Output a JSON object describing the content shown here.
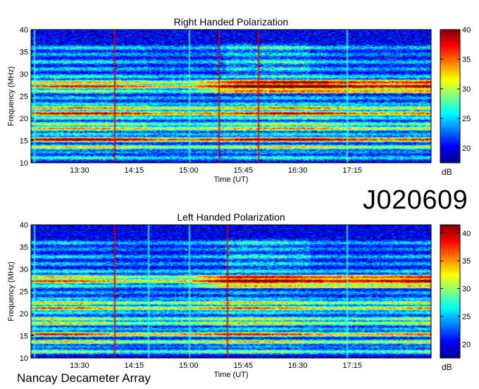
{
  "figure": {
    "observation_code": "J020609",
    "footer": "Nancay Decameter Array"
  },
  "colors": {
    "colormap": [
      "#00008f",
      "#0000ff",
      "#0080ff",
      "#00ffff",
      "#80ff80",
      "#ffff00",
      "#ff8000",
      "#ff0000",
      "#800000"
    ]
  },
  "chart_data": [
    {
      "type": "heatmap",
      "title": "Right Handed Polarization",
      "xlabel": "Time (UT)",
      "ylabel": "Frequency (MHz)",
      "x_ticks": [
        "13:30",
        "14:15",
        "15:00",
        "15:45",
        "16:30",
        "17:15"
      ],
      "x_tick_minutes": [
        810,
        855,
        900,
        945,
        990,
        1035
      ],
      "xlim_minutes": [
        770,
        1100
      ],
      "y_ticks": [
        10,
        15,
        20,
        25,
        30,
        35,
        40
      ],
      "ylim": [
        10,
        40
      ],
      "colorbar": {
        "label": "dB",
        "ticks": [
          20,
          25,
          30,
          35,
          40
        ],
        "range": [
          17.5,
          40
        ]
      },
      "features": {
        "background_db": 19.5,
        "bands": [
          {
            "freq_mhz": 11.2,
            "db": 27
          },
          {
            "freq_mhz": 12.5,
            "db": 24
          },
          {
            "freq_mhz": 13.6,
            "db": 32
          },
          {
            "freq_mhz": 15.3,
            "db": 40
          },
          {
            "freq_mhz": 16.5,
            "db": 26
          },
          {
            "freq_mhz": 17.8,
            "db": 34
          },
          {
            "freq_mhz": 18.8,
            "db": 30
          },
          {
            "freq_mhz": 20.2,
            "db": 28
          },
          {
            "freq_mhz": 21.2,
            "db": 38
          },
          {
            "freq_mhz": 22.4,
            "db": 34
          },
          {
            "freq_mhz": 23.3,
            "db": 26
          },
          {
            "freq_mhz": 24.7,
            "db": 25
          },
          {
            "freq_mhz": 26.2,
            "db": 29
          },
          {
            "freq_mhz": 27.3,
            "db": 37
          },
          {
            "freq_mhz": 28.2,
            "db": 33
          },
          {
            "freq_mhz": 29.5,
            "db": 27
          },
          {
            "freq_mhz": 31.2,
            "db": 25
          },
          {
            "freq_mhz": 32.8,
            "db": 26
          },
          {
            "freq_mhz": 34.5,
            "db": 24
          },
          {
            "freq_mhz": 36.0,
            "db": 26
          }
        ],
        "red_verticals_minutes": [
          839,
          925,
          957
        ],
        "cyan_verticals_minutes": [
          772,
          900,
          1030
        ]
      }
    },
    {
      "type": "heatmap",
      "title": "Left Handed Polarization",
      "xlabel": "Time (UT)",
      "ylabel": "Frequency (MHz)",
      "x_ticks": [
        "13:30",
        "14:15",
        "15:00",
        "15:45",
        "16:30",
        "17:15"
      ],
      "x_tick_minutes": [
        810,
        855,
        900,
        945,
        990,
        1035
      ],
      "xlim_minutes": [
        770,
        1100
      ],
      "y_ticks": [
        10,
        15,
        20,
        25,
        30,
        35,
        40
      ],
      "ylim": [
        10,
        40
      ],
      "colorbar": {
        "label": "dB",
        "ticks": [
          20,
          25,
          30,
          35,
          40
        ],
        "range": [
          17.5,
          41.5
        ]
      },
      "features": {
        "background_db": 19.5,
        "bands": [
          {
            "freq_mhz": 11.5,
            "db": 30
          },
          {
            "freq_mhz": 12.6,
            "db": 24
          },
          {
            "freq_mhz": 13.7,
            "db": 33
          },
          {
            "freq_mhz": 15.4,
            "db": 38
          },
          {
            "freq_mhz": 16.6,
            "db": 26
          },
          {
            "freq_mhz": 17.9,
            "db": 33
          },
          {
            "freq_mhz": 18.9,
            "db": 31
          },
          {
            "freq_mhz": 20.3,
            "db": 27
          },
          {
            "freq_mhz": 21.3,
            "db": 36
          },
          {
            "freq_mhz": 22.5,
            "db": 33
          },
          {
            "freq_mhz": 23.4,
            "db": 26
          },
          {
            "freq_mhz": 24.8,
            "db": 25
          },
          {
            "freq_mhz": 26.3,
            "db": 28
          },
          {
            "freq_mhz": 27.4,
            "db": 37
          },
          {
            "freq_mhz": 28.3,
            "db": 33
          },
          {
            "freq_mhz": 29.6,
            "db": 27
          },
          {
            "freq_mhz": 31.3,
            "db": 25
          },
          {
            "freq_mhz": 32.9,
            "db": 26
          },
          {
            "freq_mhz": 34.6,
            "db": 24
          },
          {
            "freq_mhz": 36.0,
            "db": 26
          }
        ],
        "red_verticals_minutes": [
          839,
          932
        ],
        "cyan_verticals_minutes": [
          772,
          900,
          1030,
          866
        ]
      }
    }
  ]
}
